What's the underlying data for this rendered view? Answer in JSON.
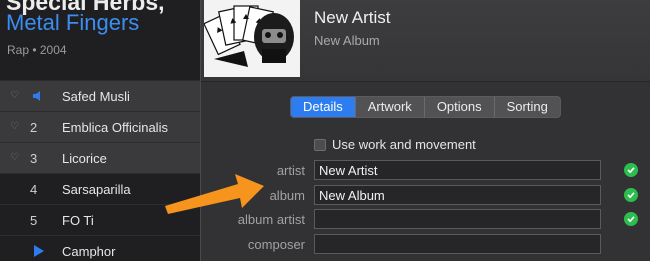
{
  "left_pane": {
    "artist": "Special Herbs,",
    "album": "Metal Fingers",
    "meta": "Rap • 2004",
    "tracks": [
      {
        "number": "",
        "name": "Safed Musli",
        "state": "playing"
      },
      {
        "number": "2",
        "name": "Emblica Officinalis",
        "state": "selected"
      },
      {
        "number": "3",
        "name": "Licorice",
        "state": "selected"
      },
      {
        "number": "4",
        "name": "Sarsaparilla",
        "state": "normal"
      },
      {
        "number": "5",
        "name": "FO Ti",
        "state": "normal"
      },
      {
        "number": "",
        "name": "Camphor",
        "state": "play"
      }
    ]
  },
  "dialog": {
    "header": {
      "artist": "New Artist",
      "album": "New Album"
    },
    "tabs": [
      {
        "label": "Details",
        "active": true
      },
      {
        "label": "Artwork",
        "active": false
      },
      {
        "label": "Options",
        "active": false
      },
      {
        "label": "Sorting",
        "active": false
      }
    ],
    "work_checkbox": {
      "label": "Use work and movement",
      "checked": false
    },
    "fields": [
      {
        "label": "artist",
        "value": "New Artist",
        "verified": true
      },
      {
        "label": "album",
        "value": "New Album",
        "verified": true
      },
      {
        "label": "album artist",
        "value": "",
        "verified": true
      },
      {
        "label": "composer",
        "value": "",
        "verified": false
      }
    ]
  },
  "colors": {
    "accent": "#2d7df0",
    "album_link": "#3b8ef0",
    "check": "#2dbd4f",
    "arrow": "#f7941d"
  }
}
